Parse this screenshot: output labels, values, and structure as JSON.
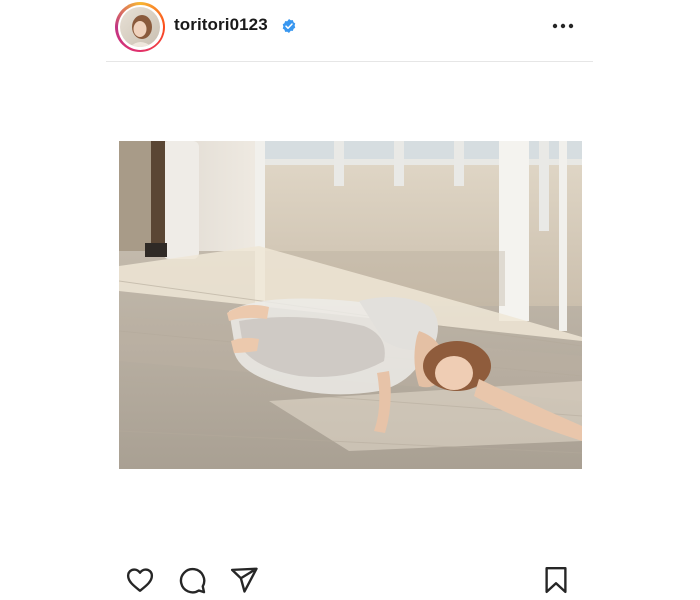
{
  "post": {
    "username": "toritori0123",
    "verified": true,
    "verified_color": "#3897f0",
    "header_icons": {
      "avatar": "profile-avatar",
      "verified": "verified-badge-icon",
      "more": "more-options-icon"
    },
    "photo": {
      "description_icon": "post-photo"
    },
    "actions": {
      "like": "heart-icon",
      "comment": "comment-icon",
      "share": "send-icon",
      "save": "bookmark-icon"
    }
  }
}
